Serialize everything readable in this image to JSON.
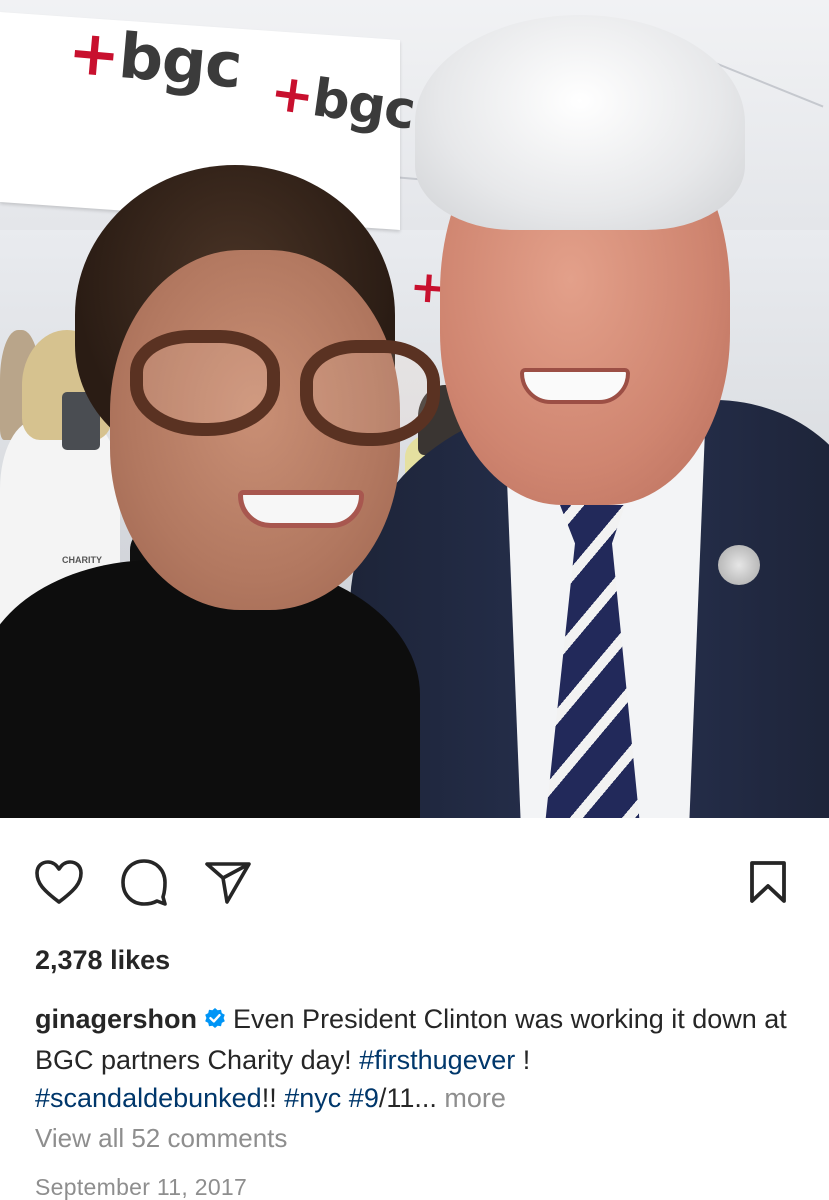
{
  "photo": {
    "logo_text": "bgc",
    "badge_text": "CHARITY"
  },
  "actions": {
    "like_icon": "heart-outline-icon",
    "comment_icon": "comment-bubble-icon",
    "share_icon": "paper-plane-icon",
    "save_icon": "bookmark-icon"
  },
  "post": {
    "likes": "2,378 likes",
    "username": "ginagershon",
    "verified_color": "#0095f6",
    "caption_text_1": "Even President Clinton was working it down at BGC partners Charity day!",
    "hashtag_1": "#firsthugever",
    "caption_text_2": "!",
    "hashtag_2": "#scandaldebunked",
    "caption_text_3": "!!",
    "hashtag_3": "#nyc",
    "hashtag_4": "#9",
    "caption_text_4": "/11...",
    "more_label": "more",
    "view_comments": "View all 52 comments",
    "date": "September 11, 2017"
  },
  "colors": {
    "text": "#262626",
    "hashtag": "#00376b",
    "muted": "#8e8e8e",
    "logo_accent": "#c8102e"
  }
}
